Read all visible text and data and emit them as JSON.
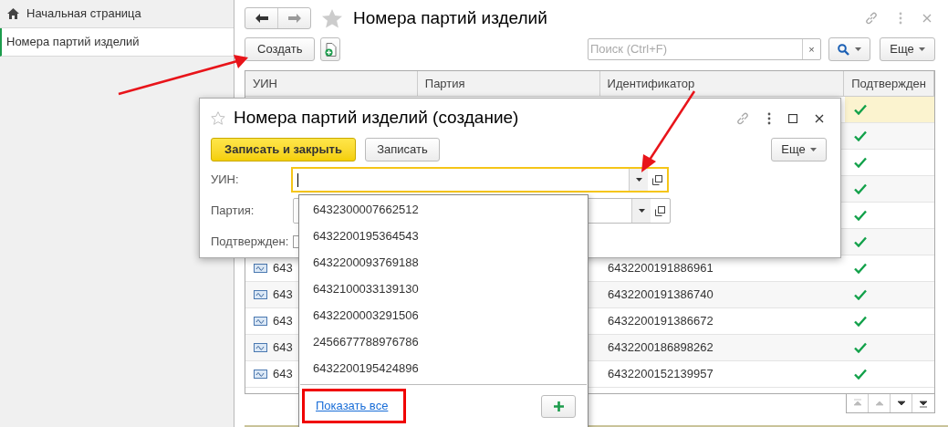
{
  "sidebar": {
    "items": [
      {
        "label": "Начальная страница",
        "kind": "home",
        "selected": false
      },
      {
        "label": "Номера партий изделий",
        "kind": "page",
        "selected": true
      }
    ]
  },
  "form": {
    "title": "Номера партий изделий",
    "create_button": "Создать",
    "search": {
      "placeholder": "Поиск (Ctrl+F)",
      "clear": "×"
    },
    "more_button": "Еще"
  },
  "table": {
    "columns": [
      "УИН",
      "Партия",
      "Идентификатор",
      "Подтвержден"
    ],
    "rows": [
      {
        "confirmed": true,
        "selected": true
      },
      {
        "confirmed": true,
        "selected": false
      },
      {
        "confirmed": true,
        "selected": false
      },
      {
        "confirmed": true,
        "selected": false
      },
      {
        "confirmed": true,
        "selected": false
      },
      {
        "confirmed": true,
        "selected": false
      },
      {
        "uin": "643",
        "identifier": "6432200191886961",
        "confirmed": true,
        "selected": false
      },
      {
        "uin": "643",
        "identifier": "6432200191386740",
        "confirmed": true,
        "selected": false
      },
      {
        "uin": "643",
        "identifier": "6432200191386672",
        "confirmed": true,
        "selected": false
      },
      {
        "uin": "643",
        "identifier": "6432200186898262",
        "confirmed": true,
        "selected": false
      },
      {
        "uin": "643",
        "identifier": "6432200152139957",
        "confirmed": true,
        "selected": false
      }
    ]
  },
  "dialog": {
    "title": "Номера партий изделий (создание)",
    "save_close_button": "Записать и закрыть",
    "save_button": "Записать",
    "more_button": "Еще",
    "fields": [
      {
        "label": "УИН:",
        "kind": "select",
        "focused": true
      },
      {
        "label": "Партия:",
        "kind": "select",
        "focused": false
      },
      {
        "label": "Подтвержден:",
        "kind": "checkbox",
        "checked": false
      }
    ]
  },
  "dropdown": {
    "items": [
      "6432300007662512",
      "6432200195364543",
      "6432200093769188",
      "6432100033139130",
      "6432200003291506",
      "2456677788976786",
      "6432200195424896"
    ],
    "show_all_link": "Показать все"
  }
}
